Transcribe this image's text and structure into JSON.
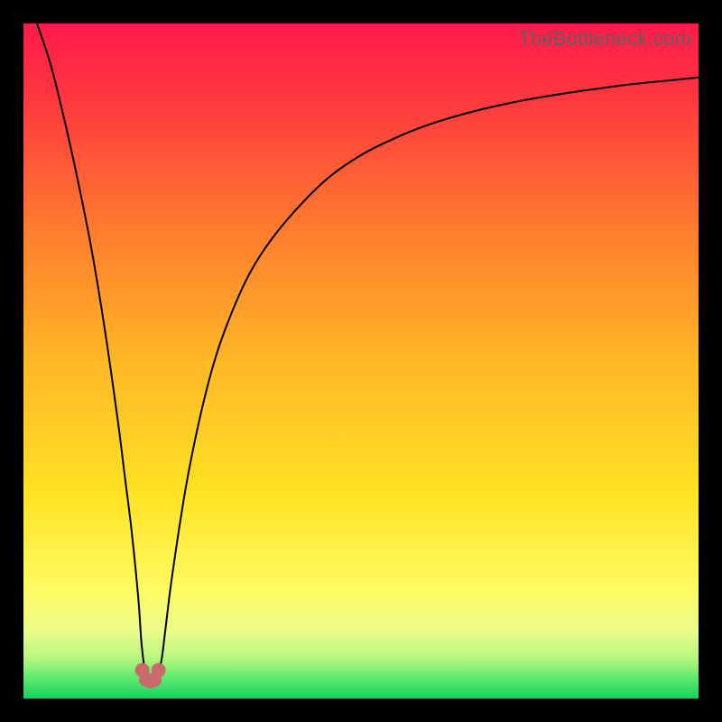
{
  "watermark": "TheBottleneck.com",
  "chart_data": {
    "type": "line",
    "title": "",
    "xlabel": "",
    "ylabel": "",
    "xlim": [
      0,
      100
    ],
    "ylim": [
      0,
      100
    ],
    "grid": false,
    "background_gradient": {
      "stops": [
        {
          "offset": 0.0,
          "color": "#ff1a4b"
        },
        {
          "offset": 0.12,
          "color": "#ff3a3e"
        },
        {
          "offset": 0.3,
          "color": "#ff7a2e"
        },
        {
          "offset": 0.5,
          "color": "#ffb726"
        },
        {
          "offset": 0.7,
          "color": "#ffe324"
        },
        {
          "offset": 0.84,
          "color": "#fffb63"
        },
        {
          "offset": 0.9,
          "color": "#eafc8a"
        },
        {
          "offset": 0.94,
          "color": "#b7f77f"
        },
        {
          "offset": 0.97,
          "color": "#5de96f"
        },
        {
          "offset": 1.0,
          "color": "#18cf5a"
        }
      ]
    },
    "series": [
      {
        "name": "bottleneck-curve",
        "color": "#000000",
        "width": 2,
        "x": [
          2,
          4,
          6,
          8,
          10,
          12,
          14,
          15,
          16,
          17,
          17.5,
          18,
          18.3,
          18.6,
          19,
          19.5,
          20,
          20.5,
          21,
          22,
          24,
          26,
          28,
          30,
          33,
          36,
          40,
          45,
          50,
          55,
          60,
          66,
          72,
          78,
          84,
          90,
          96,
          100
        ],
        "y": [
          100,
          94,
          86,
          77,
          67,
          55,
          41,
          33,
          25,
          15,
          8,
          4,
          3,
          3,
          3,
          3.2,
          4,
          6,
          10,
          18,
          31,
          41,
          49,
          55,
          62,
          67,
          72,
          77,
          80.5,
          83,
          85,
          86.8,
          88.2,
          89.3,
          90.2,
          91,
          91.6,
          92
        ]
      }
    ],
    "marker_cluster": {
      "color": "#c96a6d",
      "radius": 8,
      "points": [
        {
          "x": 17.6,
          "y": 4.2
        },
        {
          "x": 18.2,
          "y": 2.8
        },
        {
          "x": 18.8,
          "y": 2.6
        },
        {
          "x": 19.4,
          "y": 2.8
        },
        {
          "x": 20.0,
          "y": 4.2
        }
      ]
    }
  }
}
